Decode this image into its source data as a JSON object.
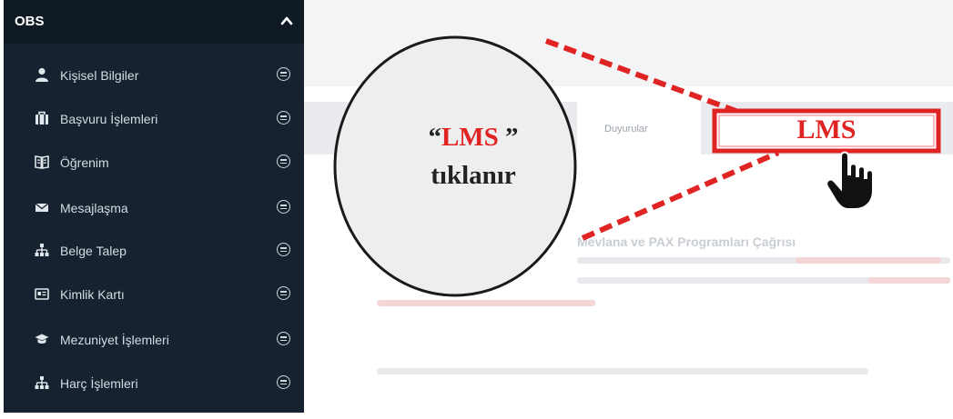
{
  "sidebar": {
    "title": "OBS",
    "collapse_icon": "chevron-up-icon",
    "items": [
      {
        "label": "Kişisel Bilgiler",
        "icon": "user-icon"
      },
      {
        "label": "Başvuru İşlemleri",
        "icon": "briefcase-icon"
      },
      {
        "label": "Öğrenim",
        "icon": "book-icon"
      },
      {
        "label": "Mesajlaşma",
        "icon": "envelope-icon"
      },
      {
        "label": "Belge Talep",
        "icon": "sitemap-icon"
      },
      {
        "label": "Kimlik Kartı",
        "icon": "id-card-icon"
      },
      {
        "label": "Mezuniyet İşlemleri",
        "icon": "graduation-cap-icon"
      },
      {
        "label": "Harç İşlemleri",
        "icon": "sitemap-icon"
      }
    ],
    "more_icon": "circle-menu-icon"
  },
  "main": {
    "tab_label": "Duyurular",
    "announcement_title": "Mevlana ve PAX Programları Çağrısı"
  },
  "annotation": {
    "circle_text_open": "“",
    "circle_text_highlight": "LMS",
    "circle_text_close": " ”",
    "circle_text_line2": "tıklanır",
    "box_label": "LMS",
    "accent_color": "#e02424",
    "cursor_icon": "hand-pointer-icon"
  }
}
